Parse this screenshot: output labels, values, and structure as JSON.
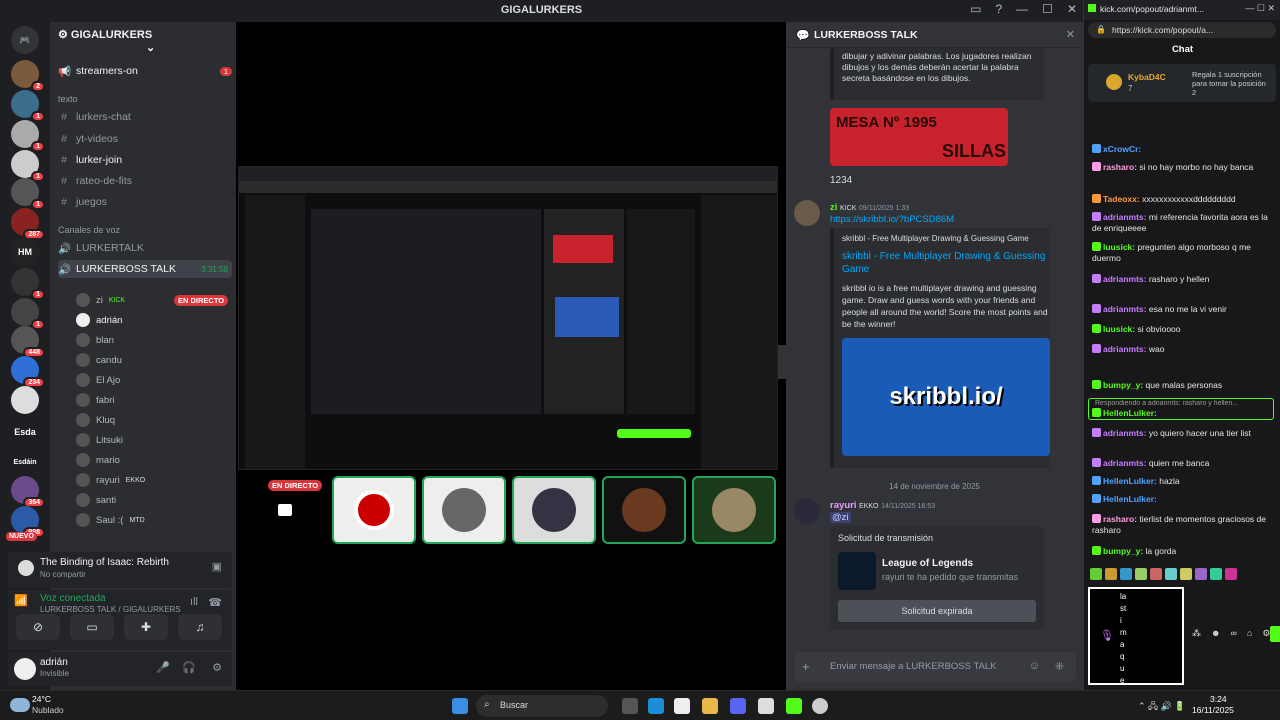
{
  "window": {
    "title": "GIGALURKERS"
  },
  "server": {
    "name": "GIGALURKERS",
    "rail_labels": {
      "hm": "HM",
      "esda": "Esda",
      "esdain": "Esdáin",
      "nuevo": "NUEVO"
    },
    "rail_badges": [
      "2",
      "1",
      "1",
      "1",
      "1",
      "287",
      "1",
      "1",
      "448",
      "234",
      "364",
      "998"
    ]
  },
  "channels": {
    "streamers_on": "streamers-on",
    "streamers_badge": "1",
    "category_text": "texto",
    "text": [
      "lurkers-chat",
      "yt-videos",
      "lurker-join",
      "rateo-de-fits",
      "juegos"
    ],
    "category_voice": "Canales de voz",
    "voice1": "LURKERTALK",
    "voice2": "LURKERBOSS TALK",
    "voice2_time": "3:31:58",
    "live_label": "EN DIRECTO",
    "members": [
      "zi",
      "adrián",
      "blan",
      "candu",
      "El Ajo",
      "fabri",
      "Kluq",
      "Litsuki",
      "mario",
      "rayuri",
      "santi",
      "Saul :("
    ],
    "member_tags": {
      "zi": "KICK",
      "rayuri": "EKKO",
      "saul": "MTD"
    }
  },
  "activity": {
    "game": "The Binding of Isaac: Rebirth",
    "sub": "No compartir"
  },
  "voice": {
    "status": "Voz conectada",
    "channel": "LURKERBOSS TALK / GIGALURKERS"
  },
  "user": {
    "name": "adrián",
    "status": "Invisible"
  },
  "stage": {
    "live_label": "EN DIRECTO"
  },
  "chat": {
    "header": "LURKERBOSS TALK",
    "embed1_text": "dibujar y adivinar palabras. Los jugadores realizan dibujos y los demás deberán acertar la palabra secreta basándose en los dibujos.",
    "img_caption_1": "MESA Nº 1995",
    "img_caption_2": "SILLAS",
    "msg_1234": "1234",
    "msg2_user": "zi",
    "msg2_tag": "KICK",
    "msg2_time": "09/11/2025 1:33",
    "msg2_link": "https://skribbl.io/?bPCSD86M",
    "embed2_site": "skribbl - Free Multiplayer Drawing & Guessing Game",
    "embed2_title": "skribbl - Free Multiplayer Drawing & Guessing Game",
    "embed2_desc": "skribbl io is a free multiplayer drawing and guessing game. Draw and guess words with your friends and people all around the world! Score the most points and be the winner!",
    "skribbl_logo": "skribbl.io/",
    "date_divider": "14 de noviembre de 2025",
    "msg3_user": "rayuri",
    "msg3_tag": "EKKO",
    "msg3_time": "14/11/2025 16:53",
    "msg3_mention": "@zi",
    "req_title": "Solicitud de transmisión",
    "req_game": "League of Legends",
    "req_sub": "rayuri te ha pedido que transmitas",
    "req_button": "Solicitud expirada",
    "input_placeholder": "Enviar mensaje a LURKERBOSS TALK"
  },
  "kick": {
    "url": "https://kick.com/popout/a...",
    "tab_title": "kick.com/popout/adrianmt...",
    "chat_title": "Chat",
    "sub_user": "KybaD4C",
    "sub_count": "7",
    "sub_text": "Regala 1 suscripción para tomar la posición 2",
    "messages": [
      {
        "u": "xCrowCr:",
        "t": "",
        "c": "#4fa3ff"
      },
      {
        "u": "rasharo:",
        "t": "si no hay morbo no hay banca",
        "c": "#ff9ee0"
      },
      {
        "u": "Tadeoxx:",
        "t": "xxxxxxxxxxxxddddddddd",
        "c": "#ff9a3c"
      },
      {
        "u": "adrianmts:",
        "t": "mi referencia favorita aora es la de enriqueeee",
        "c": "#c77dff"
      },
      {
        "u": "luusick:",
        "t": "pregunten algo morboso q me duermo",
        "c": "#53fc18"
      },
      {
        "u": "adrianmts:",
        "t": "rasharo y hellen",
        "c": "#c77dff"
      },
      {
        "u": "adrianmts:",
        "t": "esa no me la vi venir",
        "c": "#c77dff"
      },
      {
        "u": "luusick:",
        "t": "si obvioooo",
        "c": "#53fc18"
      },
      {
        "u": "adrianmts:",
        "t": "wao",
        "c": "#c77dff"
      },
      {
        "u": "bumpy_y:",
        "t": "que malas personas",
        "c": "#53fc18"
      },
      {
        "u": "HellenLulker:",
        "t": "",
        "c": "#53fc18"
      },
      {
        "u": "adrianmts:",
        "t": "yo quiero hacer una tier list",
        "c": "#c77dff"
      },
      {
        "u": "adrianmts:",
        "t": "quien me banca",
        "c": "#c77dff"
      },
      {
        "u": "HellenLulker:",
        "t": "hazla",
        "c": "#4fa3ff"
      },
      {
        "u": "HellenLulker:",
        "t": "",
        "c": "#4fa3ff"
      },
      {
        "u": "rasharo:",
        "t": "tierlist de momentos graciosos de rasharo",
        "c": "#ff9ee0"
      },
      {
        "u": "bumpy_y:",
        "t": "la gorda",
        "c": "#53fc18"
      }
    ],
    "reply_hint": "Respondiendo a adrianmts: rasharo y hellen...",
    "input_text": "la st i m a q u e"
  },
  "taskbar": {
    "temp": "24°C",
    "weather": "Nublado",
    "search": "Buscar",
    "time": "3:24",
    "date": "16/11/2025"
  },
  "colors": {
    "accent": "#53fc18",
    "live": "#da373c",
    "discord_bg": "#313338"
  }
}
